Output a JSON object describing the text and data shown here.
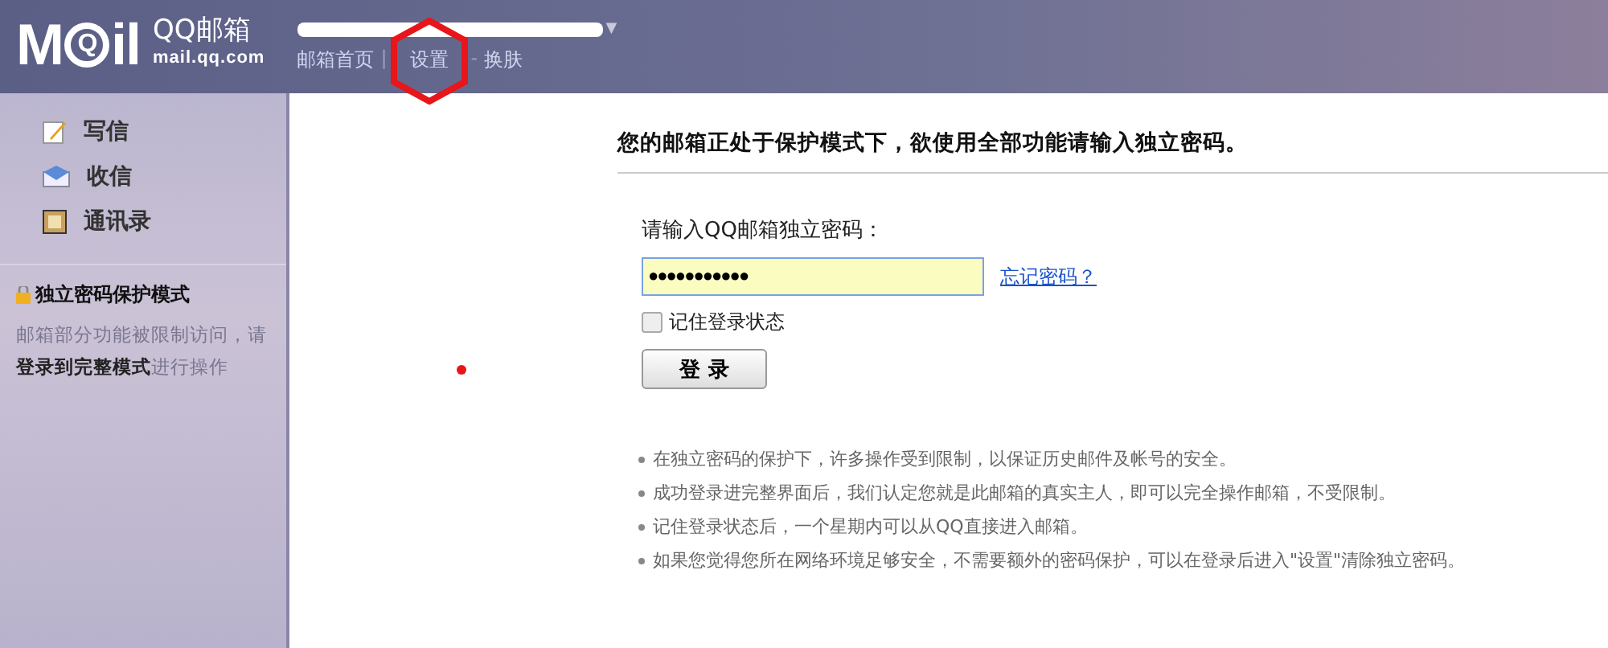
{
  "header": {
    "logo": {
      "mark": "M",
      "q": "Q",
      "mark_tail": "il",
      "name": "QQ邮箱",
      "domain": "mail.qq.com"
    },
    "account_caret": "▼",
    "nav": [
      {
        "label": "邮箱首页",
        "separator": "|",
        "circled": false
      },
      {
        "label": "设置",
        "separator": "-",
        "circled": true
      },
      {
        "label": "换肤",
        "circled": false
      }
    ]
  },
  "sidebar": {
    "items": [
      {
        "label": "写信",
        "kind": "compose"
      },
      {
        "label": "收信",
        "kind": "inbox"
      },
      {
        "label": "通讯录",
        "kind": "contacts"
      }
    ],
    "notice": {
      "title": "独立密码保护模式",
      "text": "邮箱部分功能被限制访问，请",
      "link": "登录到完整模式",
      "tail": "进行操作"
    }
  },
  "main": {
    "heading": "您的邮箱正处于保护模式下，欲使用全部功能请输入独立密码。",
    "password_label": "请输入QQ邮箱独立密码：",
    "password_value": "●●●●●●●●●●●",
    "forgot_link": "忘记密码？",
    "remember": {
      "label": "记住登录状态",
      "checked": false
    },
    "login_button": "登 录",
    "tips": [
      "在独立密码的保护下，许多操作受到限制，以保证历史邮件及帐号的安全。",
      "成功登录进完整界面后，我们认定您就是此邮箱的真实主人，即可以完全操作邮箱，不受限制。",
      "记住登录状态后，一个星期内可以从QQ直接进入邮箱。",
      "如果您觉得您所在网络环境足够安全，不需要额外的密码保护，可以在登录后进入\"设置\"清除独立密码。"
    ]
  }
}
